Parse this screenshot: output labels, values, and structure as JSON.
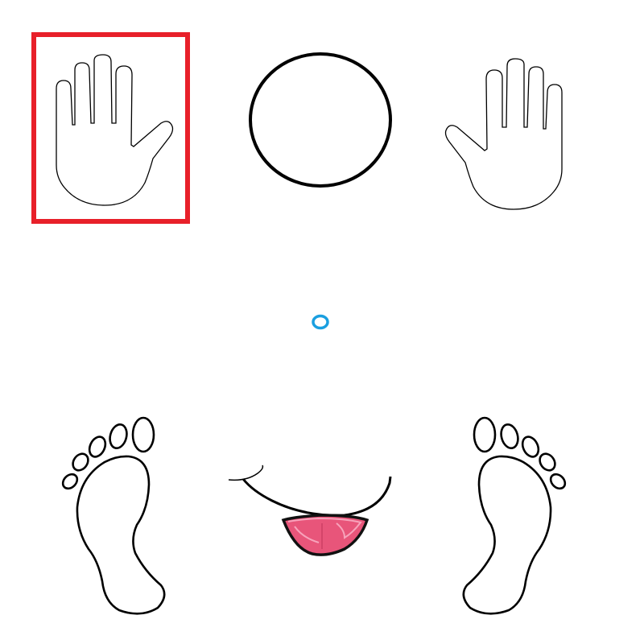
{
  "game": {
    "pieces": [
      {
        "name": "left-hand",
        "icon": "open-hand-icon",
        "selected": true
      },
      {
        "name": "head-circle",
        "icon": "circle-outline-icon",
        "selected": false
      },
      {
        "name": "right-hand",
        "icon": "open-hand-icon",
        "selected": false
      },
      {
        "name": "navel-ring",
        "icon": "small-ring-icon",
        "selected": false
      },
      {
        "name": "left-foot",
        "icon": "footprint-icon",
        "selected": false
      },
      {
        "name": "mouth-tongue",
        "icon": "smile-tongue-icon",
        "selected": false
      },
      {
        "name": "right-foot",
        "icon": "footprint-icon",
        "selected": false
      }
    ]
  },
  "colors": {
    "background": "#ffffff",
    "outline": "#000000",
    "selection": "#e8202a",
    "ring": "#1a9fe0",
    "tongue": "#e8557a",
    "tongue_highlight": "#f7a3bb"
  }
}
